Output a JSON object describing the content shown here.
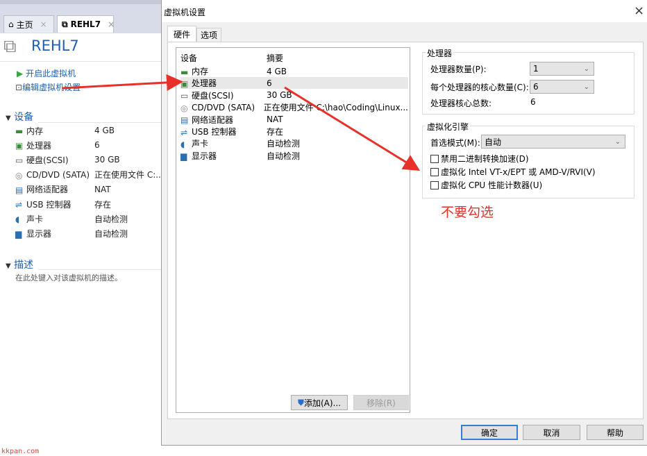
{
  "left": {
    "tabs": [
      {
        "label": "主页",
        "icon": "home-icon"
      },
      {
        "label": "REHL7",
        "icon": "vm-icon"
      }
    ],
    "title": "REHL7",
    "actions": [
      {
        "label": "开启此虚拟机",
        "icon": "play-icon"
      },
      {
        "label": "编辑虚拟机设置",
        "icon": "settings-icon"
      }
    ],
    "devices_header": "设备",
    "devices": [
      {
        "name": "内存",
        "value": "4 GB",
        "icon": "memory-icon"
      },
      {
        "name": "处理器",
        "value": "6",
        "icon": "cpu-icon"
      },
      {
        "name": "硬盘(SCSI)",
        "value": "30 GB",
        "icon": "disk-icon"
      },
      {
        "name": "CD/DVD (SATA)",
        "value": "正在使用文件 C:...",
        "icon": "cd-icon"
      },
      {
        "name": "网络适配器",
        "value": "NAT",
        "icon": "network-icon"
      },
      {
        "name": "USB 控制器",
        "value": "存在",
        "icon": "usb-icon"
      },
      {
        "name": "声卡",
        "value": "自动检测",
        "icon": "sound-icon"
      },
      {
        "name": "显示器",
        "value": "自动检测",
        "icon": "display-icon"
      }
    ],
    "desc_header": "描述",
    "desc_placeholder": "在此处键入对该虚拟机的描述。",
    "watermark": "kkpan.com"
  },
  "dialog": {
    "title": "虚拟机设置",
    "close": "×",
    "tabs": [
      "硬件",
      "选项"
    ],
    "list_headers": [
      "设备",
      "摘要"
    ],
    "devices": [
      {
        "name": "内存",
        "value": "4 GB",
        "icon": "memory-icon"
      },
      {
        "name": "处理器",
        "value": "6",
        "icon": "cpu-icon",
        "selected": true
      },
      {
        "name": "硬盘(SCSI)",
        "value": "30 GB",
        "icon": "disk-icon"
      },
      {
        "name": "CD/DVD (SATA)",
        "value": "正在使用文件 C:\\hao\\Coding\\Linux...",
        "icon": "cd-icon"
      },
      {
        "name": "网络适配器",
        "value": "NAT",
        "icon": "network-icon"
      },
      {
        "name": "USB 控制器",
        "value": "存在",
        "icon": "usb-icon"
      },
      {
        "name": "声卡",
        "value": "自动检测",
        "icon": "sound-icon"
      },
      {
        "name": "显示器",
        "value": "自动检测",
        "icon": "display-icon"
      }
    ],
    "add_button": "添加(A)...",
    "remove_button": "移除(R)",
    "processor": {
      "group": "处理器",
      "count_label": "处理器数量(P):",
      "count_value": "1",
      "cores_label": "每个处理器的核心数量(C):",
      "cores_value": "6",
      "total_label": "处理器核心总数:",
      "total_value": "6"
    },
    "virt": {
      "group": "虚拟化引擎",
      "mode_label": "首选模式(M):",
      "mode_value": "自动",
      "options": [
        {
          "label": "禁用二进制转换加速(D)",
          "checked": false
        },
        {
          "label": "虚拟化 Intel VT-x/EPT 或 AMD-V/RVI(V)",
          "checked": false
        },
        {
          "label": "虚拟化 CPU 性能计数器(U)",
          "checked": false
        }
      ]
    },
    "annotation": "不要勾选",
    "ok": "确定",
    "cancel": "取消",
    "help": "帮助"
  },
  "colors": {
    "link": "#1f5fae",
    "annotation": "#e8302a",
    "arrow": "#e8302a"
  }
}
